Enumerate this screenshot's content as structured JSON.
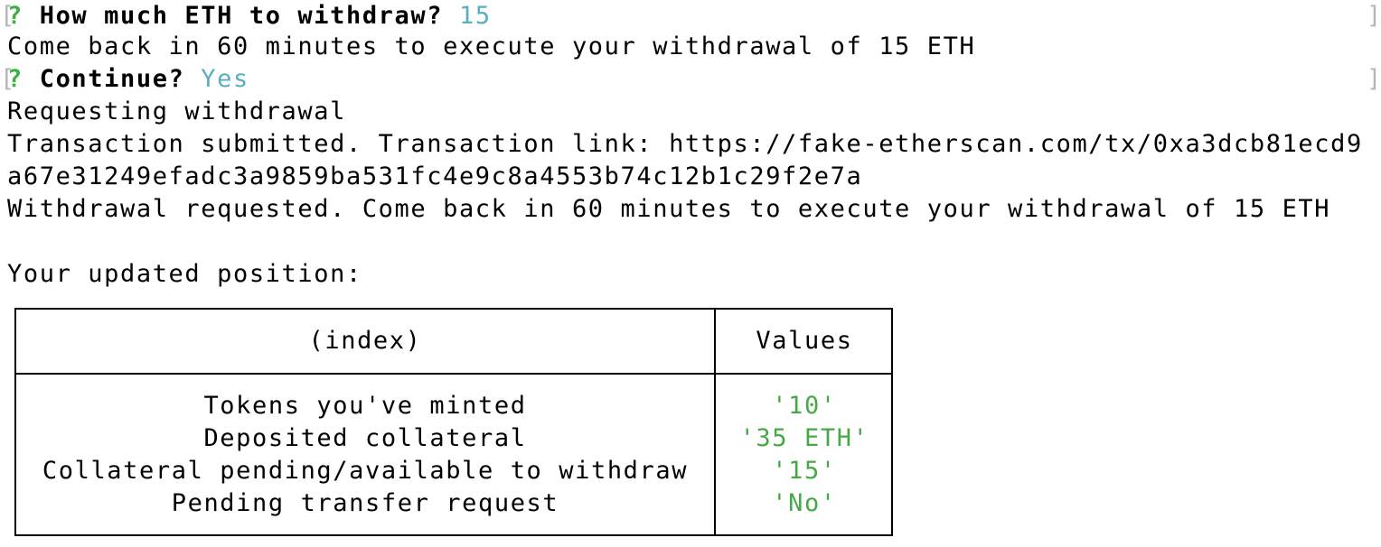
{
  "prompt1": {
    "question_mark": "?",
    "question": "How much ETH to withdraw?",
    "answer": "15"
  },
  "line_come_back": "Come back in 60 minutes to execute your withdrawal of 15 ETH",
  "prompt2": {
    "question_mark": "?",
    "question": "Continue?",
    "answer": "Yes"
  },
  "line_requesting": "Requesting withdrawal",
  "line_tx_1": "Transaction submitted. Transaction link: https://fake-etherscan.com/tx/0xa3dcb81ecd9",
  "line_tx_2": "a67e31249efadc3a9859ba531fc4e9c8a4553b74c12b1c29f2e7a",
  "line_withdrawal_requested": "Withdrawal requested. Come back in 60 minutes to execute your withdrawal of 15 ETH",
  "line_position": "Your updated position:",
  "table": {
    "header_index": "(index)",
    "header_values": "Values",
    "rows": [
      {
        "index": "Tokens you've minted",
        "value": "'10'"
      },
      {
        "index": "Deposited collateral",
        "value": "'35 ETH'"
      },
      {
        "index": "Collateral pending/available to withdraw",
        "value": "'15'"
      },
      {
        "index": "Pending transfer request",
        "value": "'No'"
      }
    ]
  },
  "colors": {
    "question_mark": "#3cb043",
    "answer": "#5aaec2",
    "value": "#46a846",
    "bracket": "#b5b5b5"
  }
}
